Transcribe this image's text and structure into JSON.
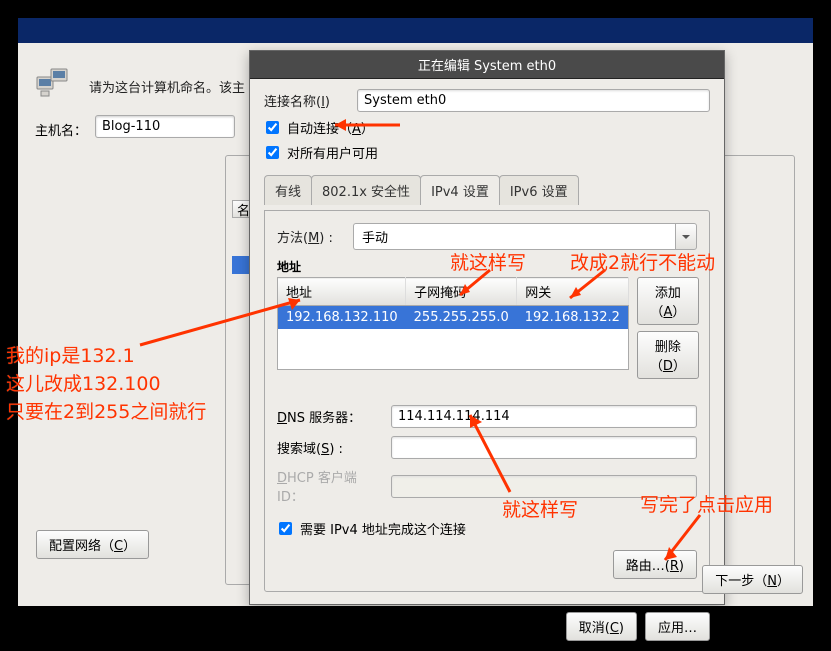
{
  "host_panel": {
    "desc": "请为这台计算机命名。该主",
    "host_label": "主机名：",
    "host_value": "Blog-110",
    "cfg_net": "配置网络（",
    "cfg_net_u": "C",
    "cfg_net2": "）",
    "list_header_char": "名"
  },
  "dialog": {
    "title": "正在编辑 System eth0",
    "conn_name_label": "连接名称(",
    "conn_name_u": "I",
    "conn_name_label2": ")",
    "conn_name_value": "System eth0",
    "auto_connect": "自动连接（",
    "auto_connect_u": "A",
    "auto_connect2": "）",
    "all_users": "对所有用户可用",
    "tabs": [
      "有线",
      "802.1x 安全性",
      "IPv4 设置",
      "IPv6 设置"
    ],
    "active_tab": 2,
    "method_label": "方法(",
    "method_u": "M",
    "method_label2": ") :",
    "method_value": "手动",
    "addr_title": "地址",
    "cols": [
      "地址",
      "子网掩码",
      "网关"
    ],
    "row": [
      "192.168.132.110",
      "255.255.255.0",
      "192.168.132.2"
    ],
    "add_btn": "添加（",
    "add_u": "A",
    "add_btn2": "）",
    "del_btn": "删除（",
    "del_u": "D",
    "del_btn2": "）",
    "dns_label_pre": "D",
    "dns_label": "NS 服务器：",
    "dns_value": "114.114.114.114",
    "search_label": "搜索域(",
    "search_u": "S",
    "search_label2": ") :",
    "dhcp_label_pre": "D",
    "dhcp_label": "HCP 客户端 ID：",
    "require_ipv4": "需要 IPv4 地址完成这个连接",
    "route_btn": "路由…(",
    "route_u": "R",
    "route_btn2": ")",
    "cancel": "取消(",
    "cancel_u": "C",
    "cancel2": ")",
    "apply": "应用…"
  },
  "next_btn": {
    "pre": "下一步（",
    "u": "N",
    "post": "）"
  },
  "annotations": {
    "a1": "就这样写",
    "a2": "改成2就行不能动",
    "a3": "我的ip是132.1\n这儿改成132.100\n只要在2到255之间就行",
    "a4": "就这样写",
    "a5": "写完了点击应用"
  }
}
